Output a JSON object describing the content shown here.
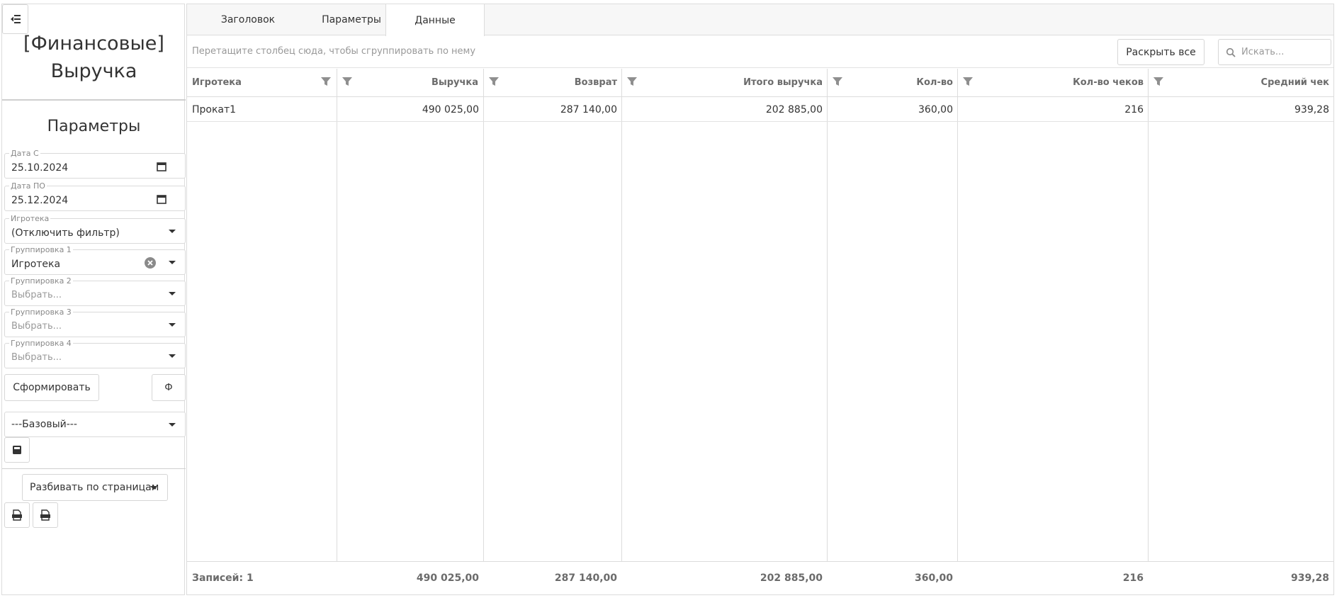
{
  "sidebar": {
    "title_line1": "[Финансовые]",
    "title_line2": "Выручка",
    "params_title": "Параметры",
    "fields": {
      "date_from": {
        "label": "Дата С",
        "value": "25.10.2024"
      },
      "date_to": {
        "label": "Дата ПО",
        "value": "25.12.2024"
      },
      "igroteka": {
        "label": "Игротека",
        "value": "(Отключить фильтр)"
      },
      "group1": {
        "label": "Группировка 1",
        "value": "Игротека"
      },
      "group2": {
        "label": "Группировка 2",
        "placeholder": "Выбрать..."
      },
      "group3": {
        "label": "Группировка 3",
        "placeholder": "Выбрать..."
      },
      "group4": {
        "label": "Группировка 4",
        "placeholder": "Выбрать..."
      }
    },
    "generate_label": "Сформировать",
    "formula_label": "Ф",
    "preset_value": "---Базовый---",
    "pager_label": "Разбивать по страницам",
    "icons": {
      "menu": "menu-collapse-icon",
      "calendar": "calendar-icon",
      "clear": "clear-icon",
      "save": "save-icon",
      "export_xls": "xls-export-icon",
      "export_pdf": "pdf-export-icon"
    }
  },
  "tabs": [
    {
      "label": "Заголовок"
    },
    {
      "label": "Параметры"
    },
    {
      "label": "Данные"
    }
  ],
  "toolbar": {
    "group_hint": "Перетащите столбец сюда, чтобы сгруппировать по нему",
    "expand_all": "Раскрыть все",
    "search_placeholder": "Искать..."
  },
  "table": {
    "columns": [
      "Игротека",
      "Выручка",
      "Возврат",
      "Итого выручка",
      "Кол-во",
      "Кол-во чеков",
      "Средний чек"
    ],
    "rows": [
      [
        "Прокат1",
        "490 025,00",
        "287 140,00",
        "202 885,00",
        "360,00",
        "216",
        "939,28"
      ]
    ],
    "footer": [
      "Записей: 1",
      "490 025,00",
      "287 140,00",
      "202 885,00",
      "360,00",
      "216",
      "939,28"
    ]
  },
  "colors": {
    "border": "#dcdcdc",
    "header_text": "#6b6b6b",
    "tabbar_bg": "#f7f7f7",
    "text": "#333333",
    "muted": "#999999"
  }
}
